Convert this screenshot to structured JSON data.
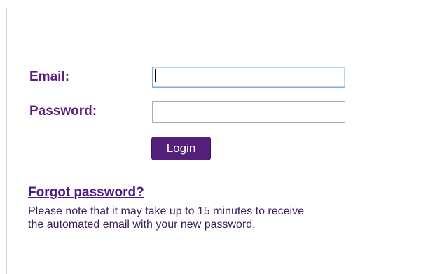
{
  "login_form": {
    "email_label": "Email:",
    "email_value": "",
    "password_label": "Password:",
    "password_value": "",
    "login_button": "Login"
  },
  "forgot": {
    "link_text": "Forgot password?",
    "note_line1": "Please note that it may take up to 15 minutes to receive",
    "note_line2": "the automated email with your new password."
  },
  "colors": {
    "accent": "#5b1f7f",
    "button_bg": "#54207a",
    "link": "#4a1a88",
    "focus_border": "#7eaedd"
  }
}
